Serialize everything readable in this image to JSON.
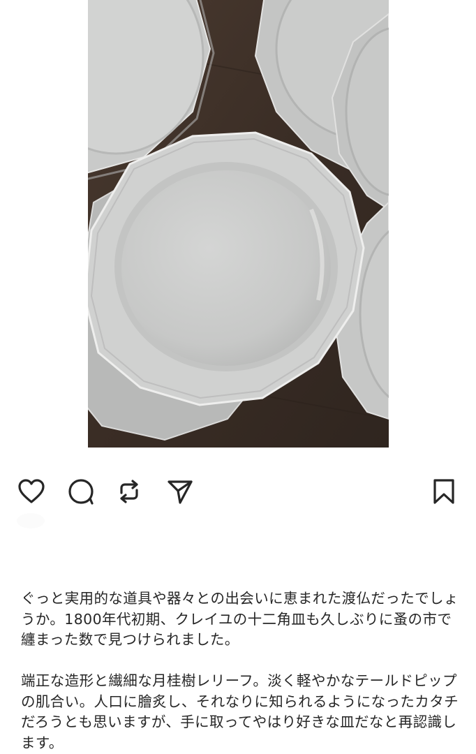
{
  "post": {
    "image": {
      "subject": "twelve-sided white plates on a dark wooden table",
      "colors": {
        "table": "#3e3129",
        "plate": "#cfd0cf",
        "plate_shadow": "#a9aaa8",
        "plate_highlight": "#e3e3e2"
      }
    },
    "actions": {
      "like_icon": "heart-icon",
      "comment_icon": "comment-icon",
      "repost_icon": "repost-icon",
      "share_icon": "send-icon",
      "save_icon": "bookmark-icon"
    },
    "caption": {
      "paragraph_1": "ぐっと実用的な道具や器々との出会いに恵まれた渡仏だったでしょうか。1800年代初期、クレイユの十二角皿も久しぶりに蚤の市で纏まった数で見つけられました。",
      "paragraph_2": "端正な造形と繊細な月桂樹レリーフ。淡く軽やかなテールドピップの肌合い。人口に膾炙し、それなりに知られるようになったカタチだろうとも思いますが、手に取ってやはり好きな皿だなと再認識します。"
    }
  },
  "colors": {
    "text": "#262626",
    "icon": "#262626",
    "background": "#ffffff"
  }
}
